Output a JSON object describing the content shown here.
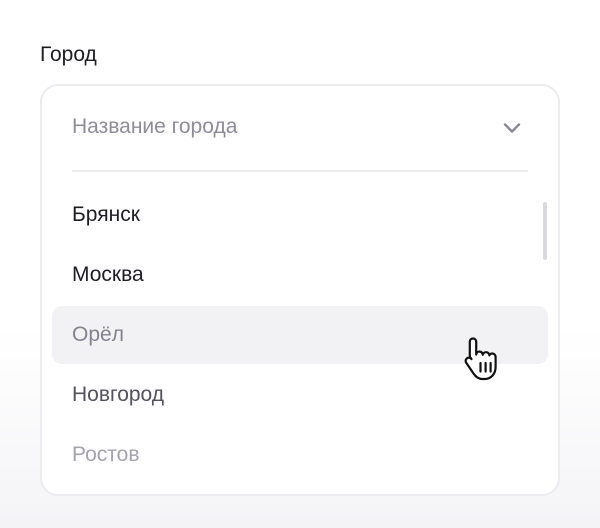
{
  "field": {
    "label": "Город"
  },
  "select": {
    "placeholder": "Название города",
    "icon": "chevron-down-icon"
  },
  "options": [
    {
      "label": "Брянск",
      "state": "default"
    },
    {
      "label": "Москва",
      "state": "default"
    },
    {
      "label": "Орёл",
      "state": "hover"
    },
    {
      "label": "Новгород",
      "state": "default"
    },
    {
      "label": "Ростов",
      "state": "faded"
    }
  ],
  "cursor": {
    "icon": "hand-pointer-icon"
  },
  "colors": {
    "text_primary": "#1e1d24",
    "text_placeholder": "#8f8c98",
    "hover_background": "#f2f2f4",
    "border": "#ececf0"
  }
}
